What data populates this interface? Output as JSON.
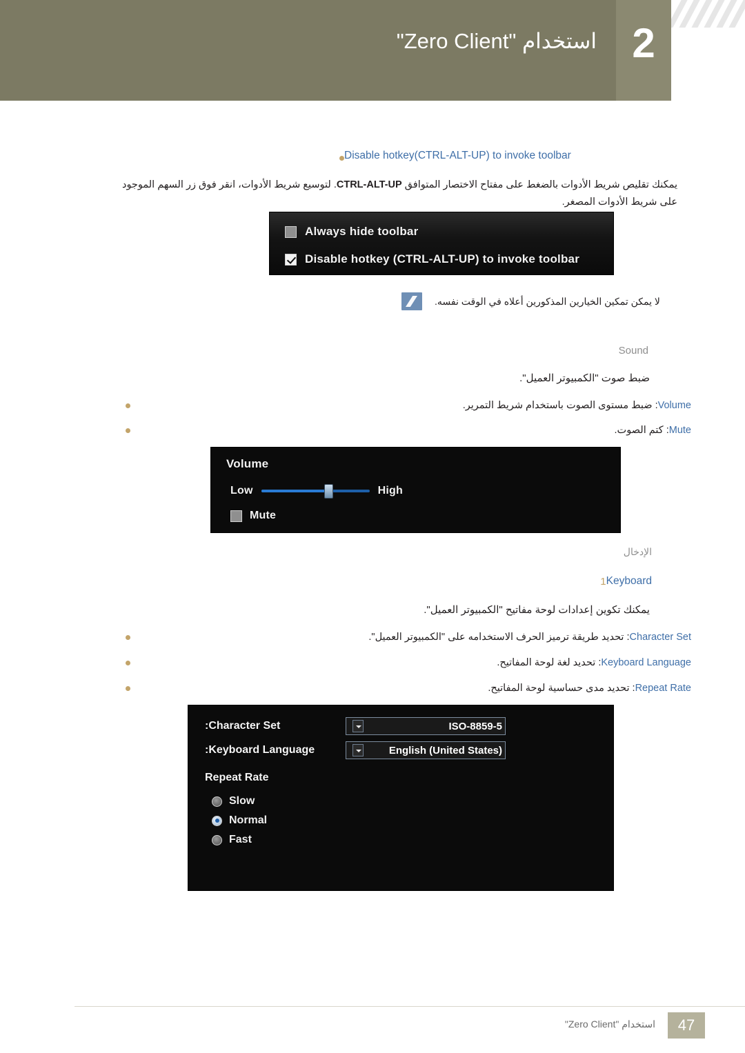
{
  "header": {
    "title": "استخدام \"Zero Client\"",
    "chapter_number": "2"
  },
  "sections": {
    "hotkey_heading": "Disable hotkey(CTRL-ALT-UP) to invoke toolbar",
    "hotkey_paragraph_prefix": "يمكنك تقليص شريط الأدوات بالضغط على مفتاح الاختصار المتوافق ",
    "hotkey_paragraph_keyword": "CTRL-ALT-UP",
    "hotkey_paragraph_suffix": ". لتوسيع شريط الأدوات، انقر فوق زر السهم الموجود على شريط الأدوات المصغر.",
    "note_text": "لا يمكن تمكين الخيارين المذكورين أعلاه في الوقت نفسه.",
    "sound_heading": "Sound",
    "sound_line": "ضبط صوت \"الكمبيوتر العميل\".",
    "volume_label": "Volume",
    "volume_desc": ": ضبط مستوى الصوت باستخدام شريط التمرير.",
    "mute_label": "Mute",
    "mute_desc": ": كتم الصوت.",
    "input_heading_ar": "الإدخال",
    "keyboard_number": "1",
    "keyboard_heading": "Keyboard",
    "keyboard_line": "يمكنك تكوين إعدادات لوحة مفاتيح \"الكمبيوتر العميل\".",
    "character_set_label": "Character Set",
    "character_set_desc": ": تحديد طريقة ترميز الحرف الاستخدامه على \"الكمبيوتر العميل\".",
    "keyboard_language_label": "Keyboard Language",
    "keyboard_language_desc": ": تحديد لغة لوحة المفاتيح.",
    "repeat_rate_label": "Repeat Rate",
    "repeat_rate_desc": ": تحديد مدى حساسية لوحة المفاتيح."
  },
  "toolbar_screenshot": {
    "always_hide_label": "Always hide toolbar",
    "always_hide_checked": false,
    "disable_hotkey_label": "Disable hotkey (CTRL-ALT-UP) to invoke toolbar",
    "disable_hotkey_checked": true
  },
  "volume_screenshot": {
    "title": "Volume",
    "low_label": "Low",
    "high_label": "High",
    "mute_label": "Mute",
    "mute_checked": false,
    "slider_position_percent": 62
  },
  "keyboard_screenshot": {
    "character_set_label": "Character Set:",
    "character_set_value": "ISO-8859-5",
    "keyboard_language_label": "Keyboard Language:",
    "keyboard_language_value": "English (United States)",
    "repeat_rate_label": "Repeat Rate",
    "options": [
      {
        "label": "Slow",
        "selected": false
      },
      {
        "label": "Normal",
        "selected": true
      },
      {
        "label": "Fast",
        "selected": false
      }
    ]
  },
  "footer": {
    "text": "استخدام \"Zero Client\"",
    "page": "47"
  },
  "colors": {
    "header_olive": "#7c7a63",
    "accent_blue": "#3f6fa8",
    "bullet_gold": "#c3a46a",
    "gray_label": "#8e8e8e"
  }
}
